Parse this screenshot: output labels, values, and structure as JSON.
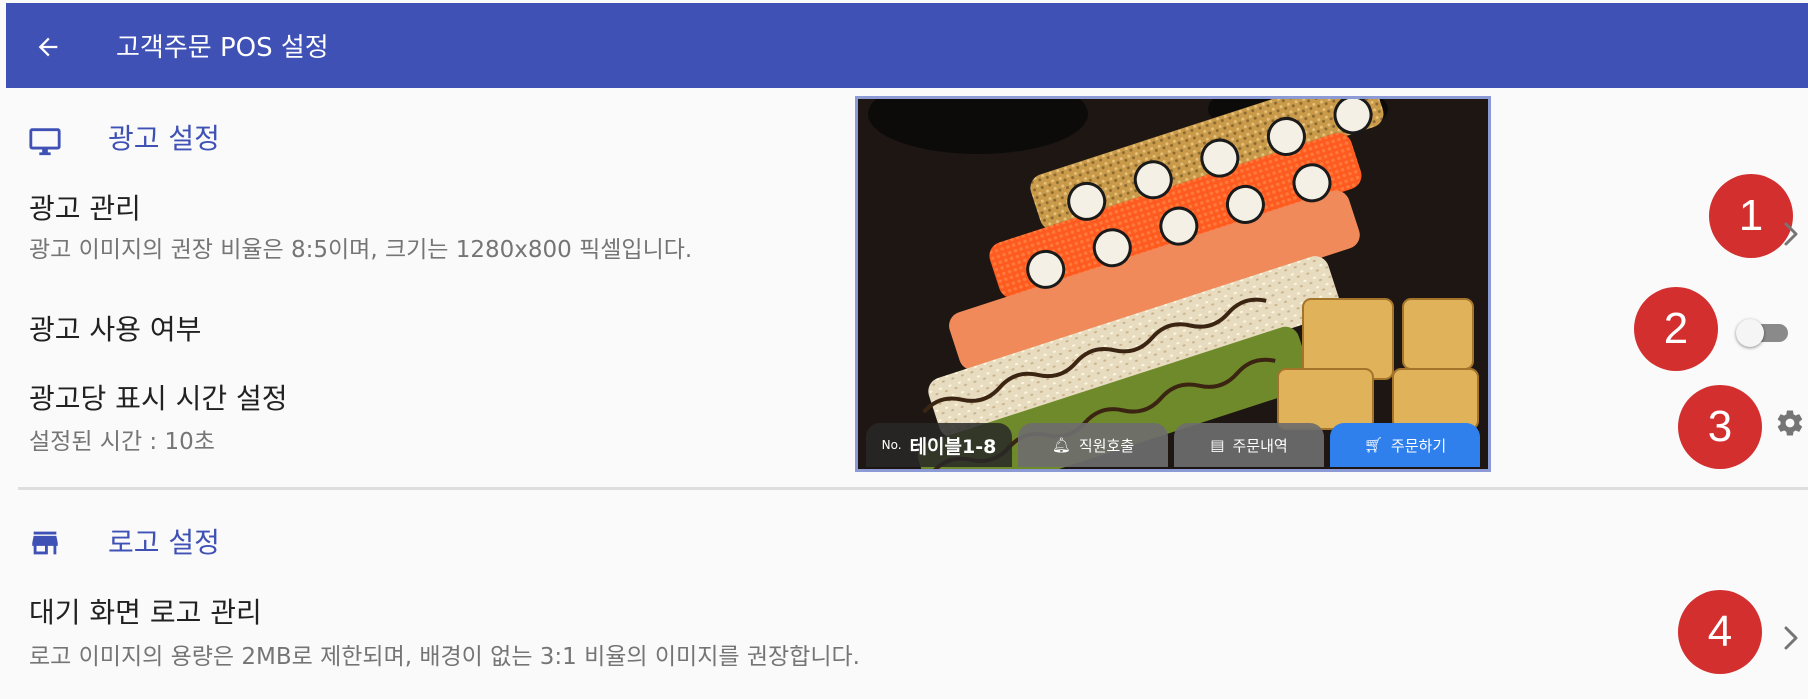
{
  "appbar": {
    "title": "고객주문 POS 설정",
    "back_icon": "arrow-left-icon"
  },
  "ad_section": {
    "title": "광고 설정",
    "icon": "monitor-icon",
    "rows": [
      {
        "title": "광고 관리",
        "desc": "광고 이미지의 권장 비율은 8:5이며, 크기는 1280x800 픽셀입니다.",
        "control": "chevron-right-icon"
      },
      {
        "title": "광고 사용 여부",
        "control": "toggle",
        "value": "off"
      },
      {
        "title": "광고당 표시 시간 설정",
        "desc": "설정된 시간 : 10초",
        "control": "gear-icon"
      }
    ]
  },
  "logo_section": {
    "title": "로고 설정",
    "icon": "store-icon",
    "rows": [
      {
        "title": "대기 화면 로고 관리",
        "desc": "로고 이미지의 용량은 2MB로 제한되며, 배경이 없는 3:1 비율의 이미지를 권장합니다.",
        "control": "chevron-right-icon"
      }
    ]
  },
  "badges": [
    "1",
    "2",
    "3",
    "4"
  ],
  "preview": {
    "table_prefix": "No.",
    "table_name": "테이블1-8",
    "staff_call": "직원호출",
    "order_history": "주문내역",
    "order": "주문하기"
  },
  "colors": {
    "primary": "#3f51b5",
    "badge": "#d32f2f",
    "order_button": "#2f80ed"
  }
}
